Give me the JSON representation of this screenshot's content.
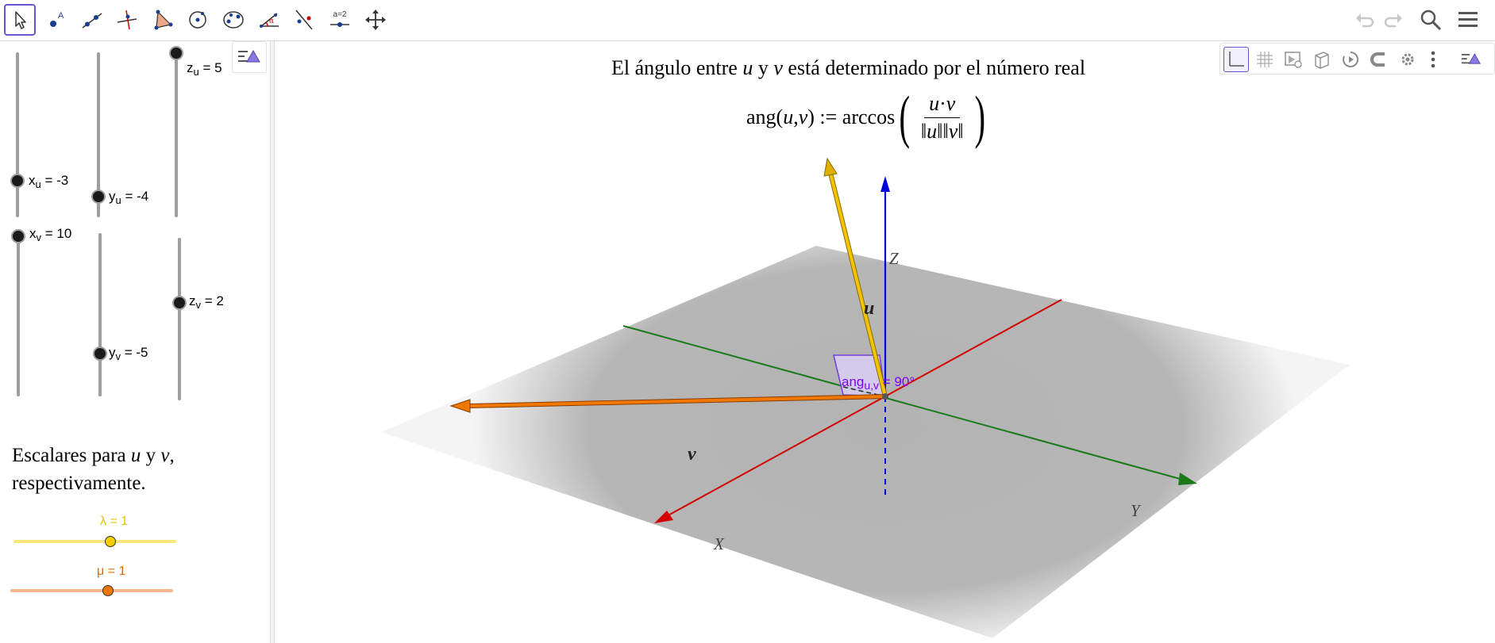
{
  "toolbar": {
    "tools": [
      {
        "name": "move-tool",
        "active": true
      },
      {
        "name": "point-tool",
        "active": false,
        "icon_text": "A"
      },
      {
        "name": "line-tool",
        "active": false
      },
      {
        "name": "perpendicular-line-tool",
        "active": false
      },
      {
        "name": "polygon-tool",
        "active": false
      },
      {
        "name": "circle-with-axis-tool",
        "active": false
      },
      {
        "name": "intersect-tool",
        "active": false
      },
      {
        "name": "angle-tool",
        "active": false,
        "icon_text": "α"
      },
      {
        "name": "reflect-tool",
        "active": false
      },
      {
        "name": "slider-tool",
        "active": false,
        "icon_text": "a=2"
      },
      {
        "name": "move-view-tool",
        "active": false
      }
    ],
    "right_icons": [
      "undo-icon",
      "redo-icon",
      "search-icon",
      "menu-icon"
    ]
  },
  "algebra": {
    "sliders": [
      {
        "name": "xu",
        "var": "x",
        "sub": "u",
        "label": " = -3",
        "value": -3
      },
      {
        "name": "yu",
        "var": "y",
        "sub": "u",
        "label": " = -4",
        "value": -4
      },
      {
        "name": "zu",
        "var": "z",
        "sub": "u",
        "label": " = 5",
        "value": 5
      },
      {
        "name": "xv",
        "var": "x",
        "sub": "v",
        "label": " = 10",
        "value": 10
      },
      {
        "name": "yv",
        "var": "y",
        "sub": "v",
        "label": " = -5",
        "value": -5
      },
      {
        "name": "zv",
        "var": "z",
        "sub": "v",
        "label": " = 2",
        "value": 2
      }
    ],
    "scalar_text_1": "Escalares para ",
    "scalar_var_u": "u",
    "scalar_text_2": " y ",
    "scalar_var_v": "v",
    "scalar_text_3": ",",
    "scalar_text_4": "respectivamente.",
    "lambda_label": "λ = 1",
    "lambda_value": 1,
    "mu_label": "μ = 1",
    "mu_value": 1
  },
  "graphics": {
    "formula_line1_a": "El ángulo entre ",
    "formula_line1_u": "u",
    "formula_line1_b": " y ",
    "formula_line1_v": "v",
    "formula_line1_c": " está determinado por el número real",
    "formula_ang": "ang(",
    "formula_u": "u",
    "formula_comma": ", ",
    "formula_v": "v",
    "formula_close": ") := arccos",
    "formula_num_u": "u",
    "formula_num_dot": "·",
    "formula_num_v": "v",
    "formula_den": "‖u‖‖v‖",
    "label_z": "Z",
    "label_x": "X",
    "label_y": "Y",
    "label_u": "u",
    "label_v": "v",
    "angle_main": "ang",
    "angle_sub": "u,v",
    "angle_value": " = 90°",
    "style_bar_icons": [
      "axes-icon",
      "grid-icon",
      "view-icon",
      "cube-icon",
      "rotate-icon",
      "magnet-icon",
      "settings-icon",
      "more-icon",
      "toggle-style-bar-icon"
    ]
  },
  "colors": {
    "accent": "#6557d2",
    "x_axis": "#d40000",
    "y_axis": "#1a7a1a",
    "z_axis": "#0000dd",
    "vector_u": "#f5c400",
    "vector_v": "#f07800",
    "angle": "#8000ff",
    "lambda_slider": "#f9e97a",
    "mu_slider": "#f7b68c"
  }
}
